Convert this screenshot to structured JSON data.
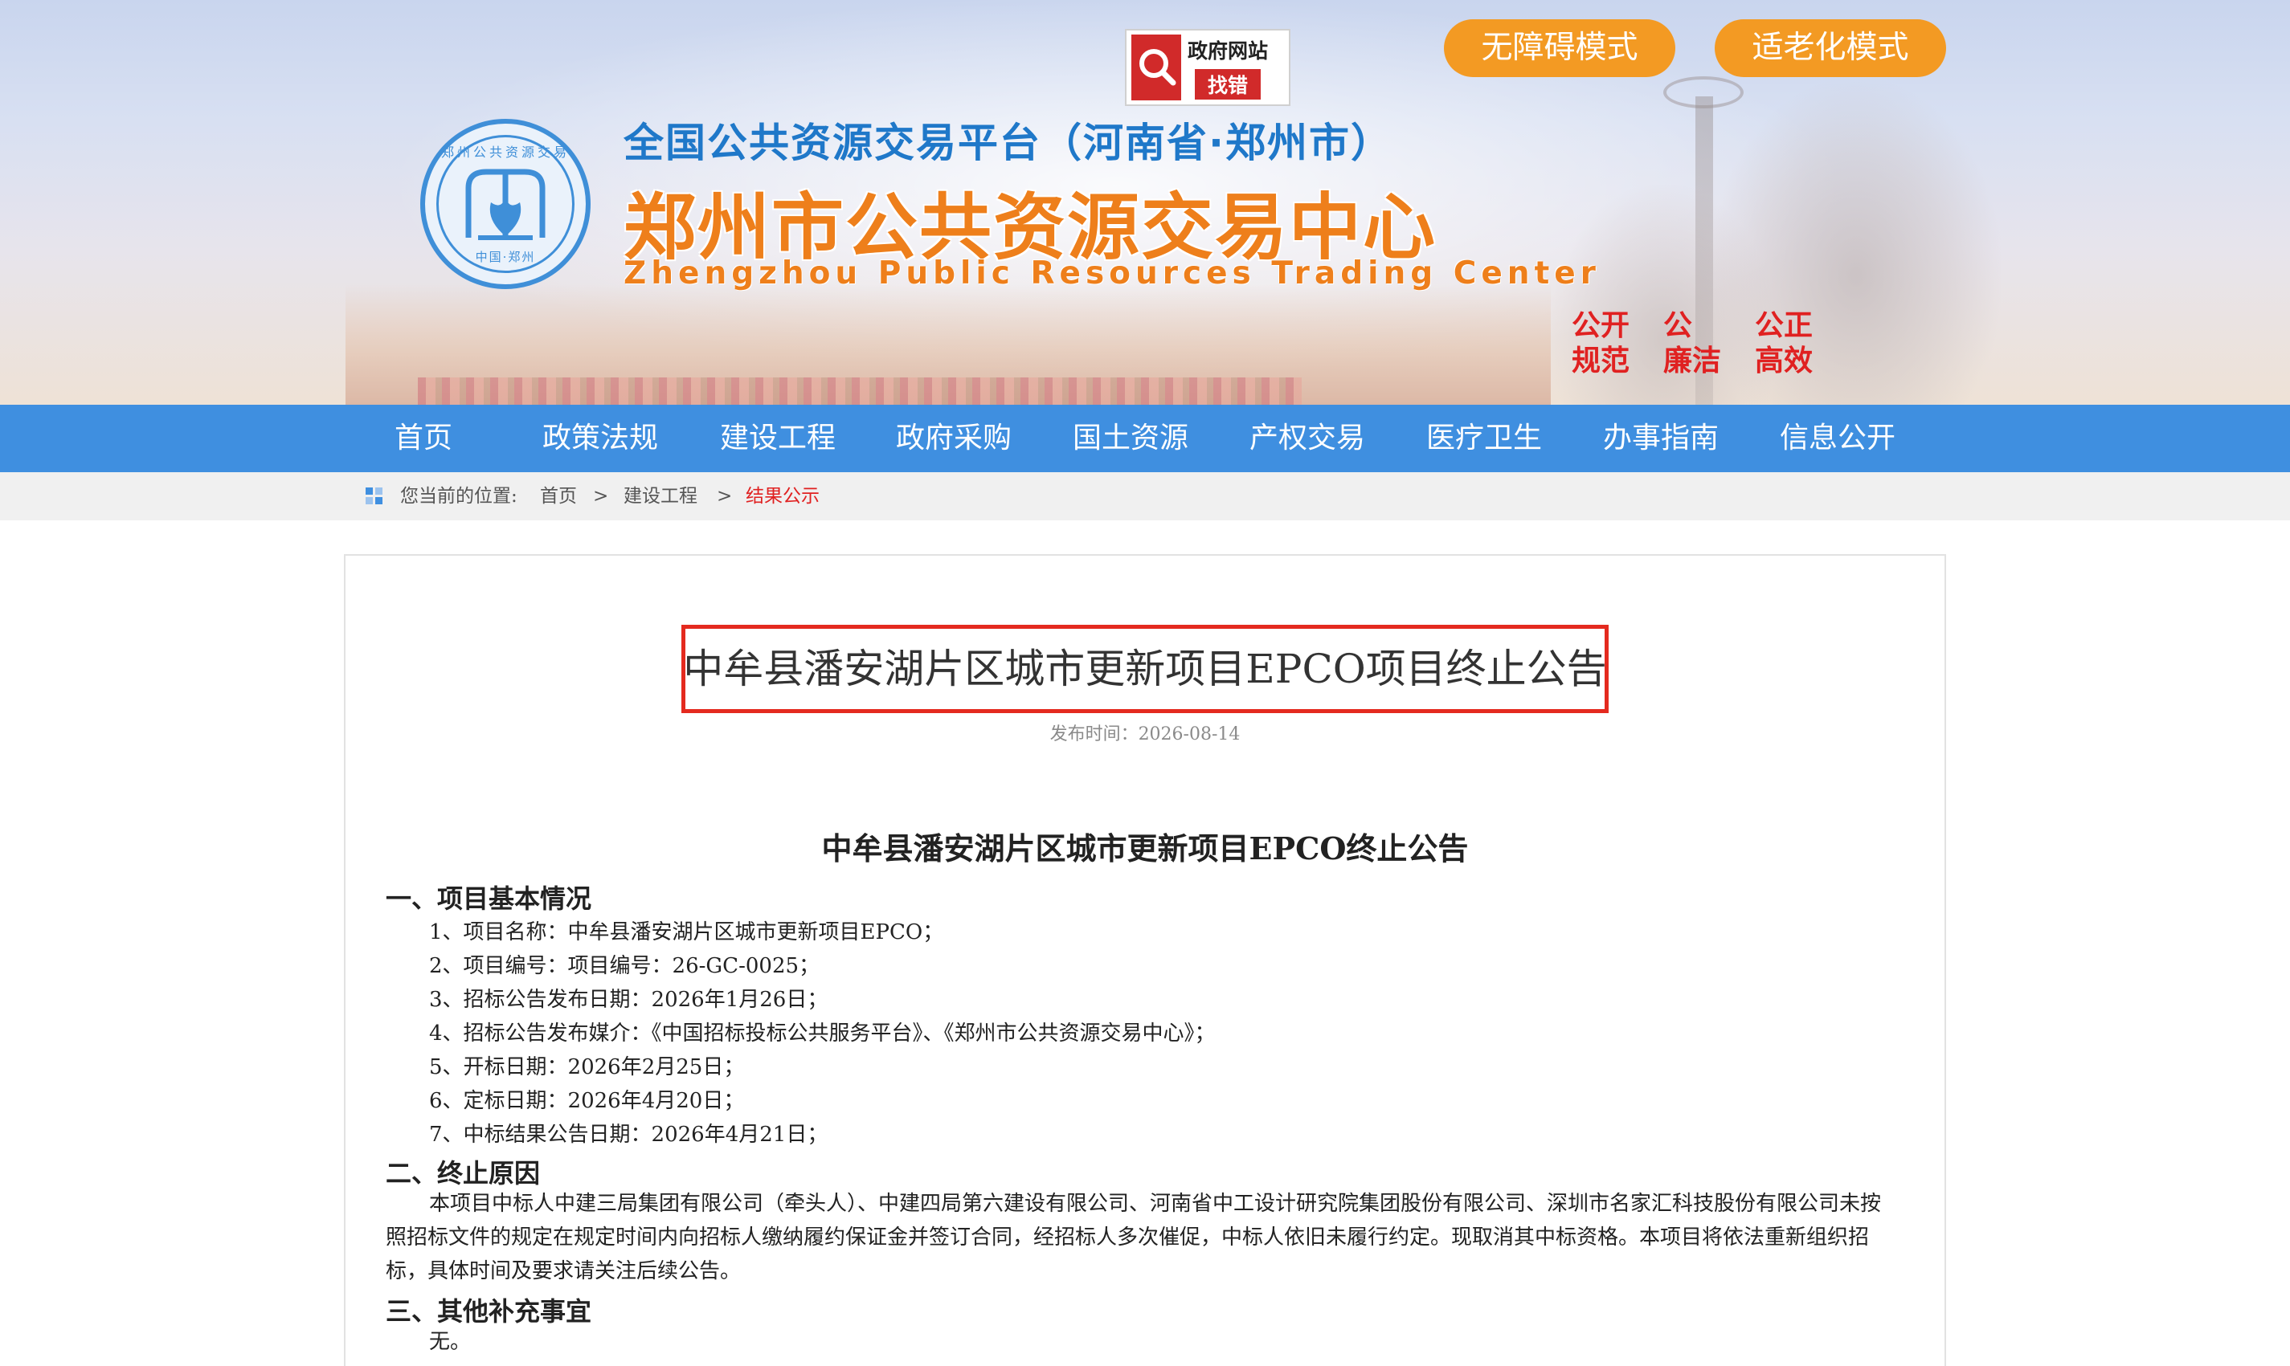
{
  "header": {
    "gov_badge": {
      "line1": "政府网站",
      "line2": "找错"
    },
    "mode_buttons": {
      "accessibility": "无障碍模式",
      "elderly": "适老化模式"
    },
    "logo": {
      "ring_top": "郑州公共资源交易",
      "ring_bottom": "中国·郑州"
    },
    "title_top": "全国公共资源交易平台（河南省·郑州市）",
    "title_main": "郑州市公共资源交易中心",
    "title_en": "Zhengzhou Public Resources Trading Center",
    "slogans": {
      "s1a": "公开",
      "s1b": "规范",
      "s2a": "公",
      "s2b": "廉洁",
      "s3a": "公正",
      "s3b": "高效"
    }
  },
  "nav": {
    "items": [
      "首页",
      "政策法规",
      "建设工程",
      "政府采购",
      "国土资源",
      "产权交易",
      "医疗卫生",
      "办事指南",
      "信息公开"
    ]
  },
  "breadcrumb": {
    "prefix": "您当前的位置:",
    "home": "首页",
    "sep": ">",
    "level1": "建设工程",
    "current": "结果公示"
  },
  "article": {
    "headline": "中牟县潘安湖片区城市更新项目EPCO项目终止公告",
    "pubdate": "发布时间：2026-08-14",
    "doc_title": "中牟县潘安湖片区城市更新项目EPCO终止公告",
    "sec1": "一、项目基本情况",
    "items": [
      "1、项目名称：中牟县潘安湖片区城市更新项目EPCO；",
      "2、项目编号：项目编号：26-GC-0025；",
      "3、招标公告发布日期：2026年1月26日；",
      "4、招标公告发布媒介：《中国招标投标公共服务平台》、《郑州市公共资源交易中心》；",
      "5、开标日期：2026年2月25日；",
      "6、定标日期：2026年4月20日；",
      "7、中标结果公告日期：2026年4月21日；"
    ],
    "sec2": "二、终止原因",
    "reason": "本项目中标人中建三局集团有限公司（牵头人）、中建四局第六建设有限公司、河南省中工设计研究院集团股份有限公司、深圳市名家汇科技股份有限公司未按照招标文件的规定在规定时间内向招标人缴纳履约保证金并签订合同，经招标人多次催促，中标人依旧未履行约定。现取消其中标资格。本项目将依法重新组织招标，具体时间及要求请关注后续公告。",
    "sec3": "三、其他补充事宜",
    "other": "无。"
  },
  "colors": {
    "nav_bg": "#3f8fe0",
    "mode_button": "#f39a23",
    "title_orange": "#ee7f1b",
    "title_blue": "#1f78c9",
    "highlight_red": "#e42a1f"
  }
}
